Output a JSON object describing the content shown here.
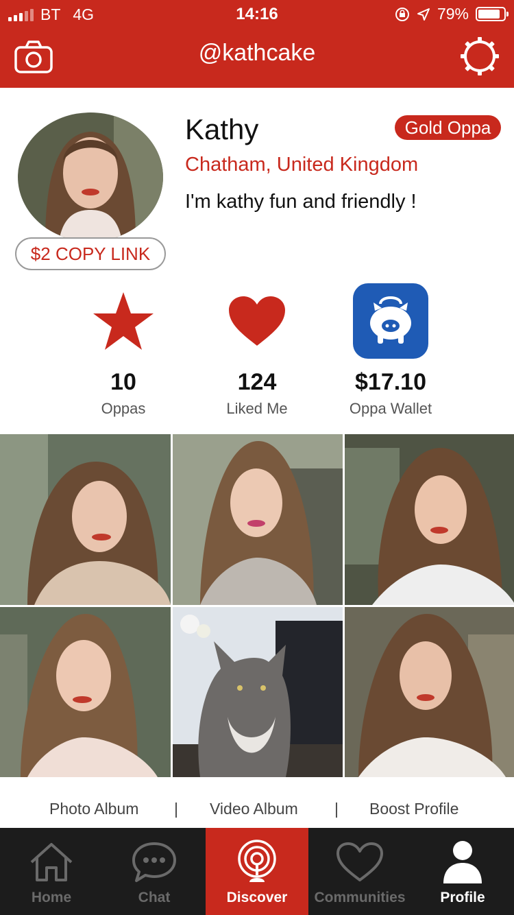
{
  "status_bar": {
    "carrier": "BT",
    "network": "4G",
    "time": "14:16",
    "battery": "79%"
  },
  "header": {
    "title": "@kathcake",
    "left_icon": "camera-icon",
    "right_icon": "gear-icon"
  },
  "profile": {
    "name": "Kathy",
    "badge": "Gold Oppa",
    "location": "Chatham, United Kingdom",
    "bio": "I'm kathy fun and friendly !",
    "copy_link": "$2 COPY LINK"
  },
  "stats": [
    {
      "icon": "star-icon",
      "value": "10",
      "label": "Oppas"
    },
    {
      "icon": "heart-icon",
      "value": "124",
      "label": "Liked Me"
    },
    {
      "icon": "piggy-bank-icon",
      "value": "$17.10",
      "label": "Oppa Wallet"
    }
  ],
  "albums": {
    "photo": "Photo Album",
    "video": "Video Album",
    "boost": "Boost Profile",
    "separator": "|"
  },
  "tabs": [
    {
      "label": "Home",
      "icon": "home-icon"
    },
    {
      "label": "Chat",
      "icon": "chat-icon"
    },
    {
      "label": "Discover",
      "icon": "discover-icon"
    },
    {
      "label": "Communities",
      "icon": "heart-outline-icon"
    },
    {
      "label": "Profile",
      "icon": "person-icon"
    }
  ],
  "colors": {
    "brand": "#c8291d",
    "tabbar": "#1c1c1c",
    "wallet": "#1f5bb5"
  }
}
